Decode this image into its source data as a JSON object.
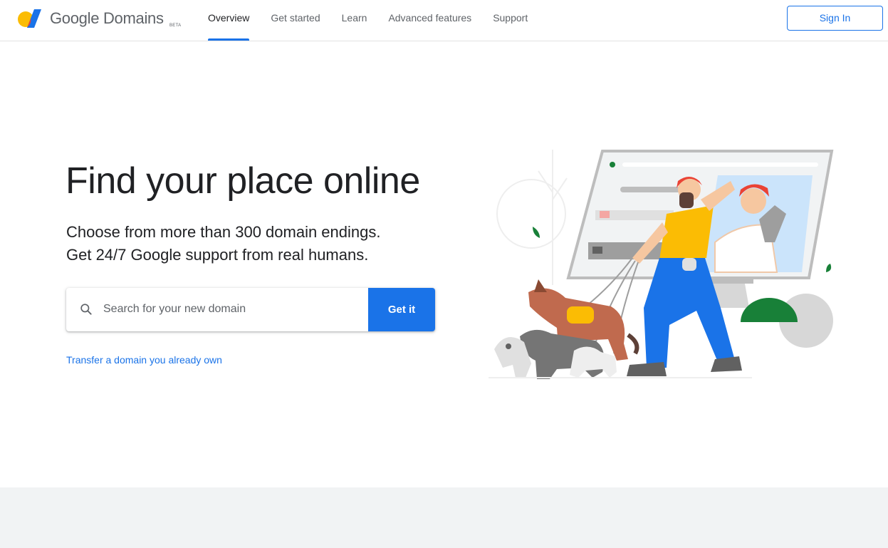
{
  "header": {
    "brand_name": "Google Domains",
    "brand_badge": "BETA",
    "logo_icon": "google-domains-logo",
    "nav": [
      {
        "label": "Overview",
        "active": true
      },
      {
        "label": "Get started",
        "active": false
      },
      {
        "label": "Learn",
        "active": false
      },
      {
        "label": "Advanced features",
        "active": false
      },
      {
        "label": "Support",
        "active": false
      }
    ],
    "sign_in_label": "Sign In"
  },
  "hero": {
    "title": "Find your place online",
    "subtitle_line1": "Choose from more than 300 domain endings.",
    "subtitle_line2": "Get 24/7 Google support from real humans.",
    "search": {
      "icon": "search-icon",
      "placeholder": "Search for your new domain",
      "value": "",
      "button_label": "Get it"
    },
    "transfer_link": "Transfer a domain you already own",
    "illustration": "person-walking-dogs-with-website-screen"
  },
  "colors": {
    "accent": "#1a73e8",
    "text_primary": "#202124",
    "text_secondary": "#5f6368",
    "footer_band": "#f1f3f4"
  }
}
